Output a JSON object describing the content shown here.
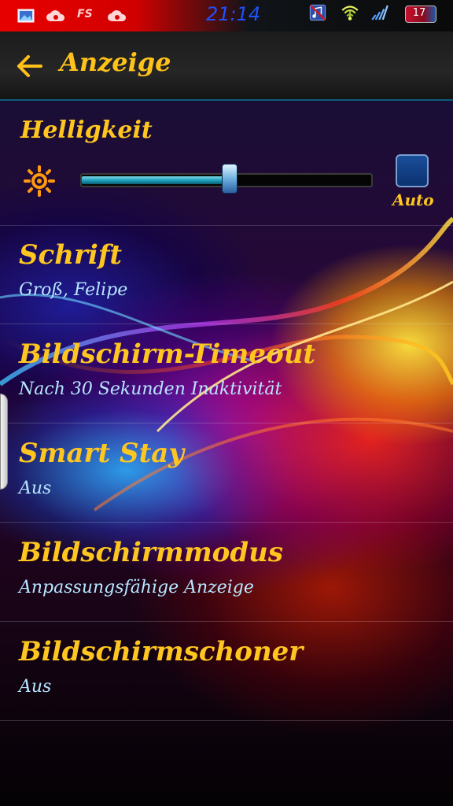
{
  "status_bar": {
    "time": "21:14",
    "fs_label": "FS",
    "battery_level": "17",
    "icons": [
      "gallery-icon",
      "cloud-icon",
      "fs-icon",
      "cloud-icon",
      "music-muted-icon",
      "wifi-icon",
      "signal-icon",
      "battery-icon"
    ]
  },
  "app_bar": {
    "title": "Anzeige",
    "back_icon": "arrow-left-icon"
  },
  "brightness": {
    "title": "Helligkeit",
    "level": 0.51,
    "auto_label": "Auto",
    "auto_checked": false
  },
  "settings": [
    {
      "title": "Schrift",
      "subtitle": "Groß, Felipe"
    },
    {
      "title": "Bildschirm-Timeout",
      "subtitle": "Nach 30 Sekunden Inaktivität"
    },
    {
      "title": "Smart Stay",
      "subtitle": "Aus"
    },
    {
      "title": "Bildschirmmodus",
      "subtitle": "Anpassungsfähige Anzeige"
    },
    {
      "title": "Bildschirmschoner",
      "subtitle": "Aus"
    }
  ],
  "colors": {
    "accent_yellow": "#ffc61f",
    "subtitle_blue": "#b6e6ff",
    "status_time_blue": "#2050ff"
  }
}
